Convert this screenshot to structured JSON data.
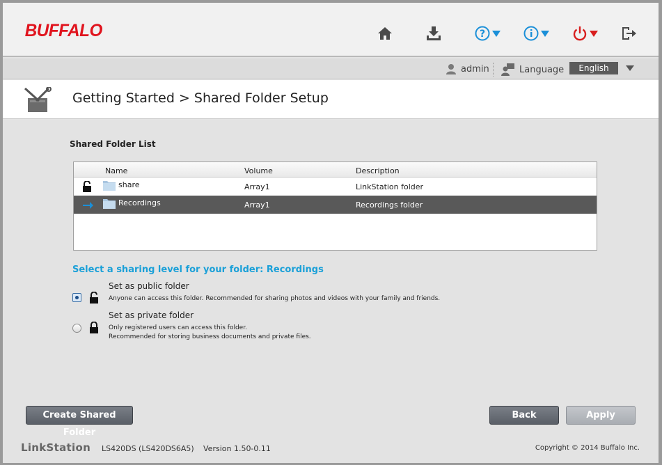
{
  "header": {
    "logo": "BUFFALO",
    "icons": [
      "home-icon",
      "download-icon",
      "help-icon",
      "info-icon",
      "power-icon",
      "logout-icon"
    ],
    "colors": {
      "brand": "#e0141e",
      "help": "#1a8fd8",
      "power": "#d81e1e"
    }
  },
  "userbar": {
    "user": "admin",
    "language_label": "Language",
    "language_value": "English"
  },
  "titlebar": {
    "title": "Getting Started > Shared Folder Setup"
  },
  "folder_list": {
    "title": "Shared Folder List",
    "columns": [
      "Name",
      "Volume",
      "Description"
    ],
    "rows": [
      {
        "name": "share",
        "volume": "Array1",
        "description": "LinkStation folder",
        "status_icon": "lock-open-icon",
        "selected": false
      },
      {
        "name": "Recordings",
        "volume": "Array1",
        "description": "Recordings folder",
        "status_icon": "arrow-right-icon",
        "selected": true
      }
    ]
  },
  "sharing": {
    "title": "Select a sharing level for your folder: Recordings",
    "options": [
      {
        "title": "Set as public folder",
        "desc1": "Anyone can access this folder. Recommended for sharing photos and videos with your family and friends.",
        "desc2": "",
        "checked": true
      },
      {
        "title": "Set as private folder",
        "desc1": "Only registered users can access this folder.",
        "desc2": "Recommended for storing business documents and private files.",
        "checked": false
      }
    ]
  },
  "buttons": {
    "create": "Create Shared Folder",
    "back": "Back",
    "apply": "Apply"
  },
  "footer": {
    "brand": "LinkStation",
    "model": "LS420DS (LS420DS6A5)",
    "version": "Version 1.50-0.11",
    "copyright": "Copyright © 2014 Buffalo Inc."
  }
}
